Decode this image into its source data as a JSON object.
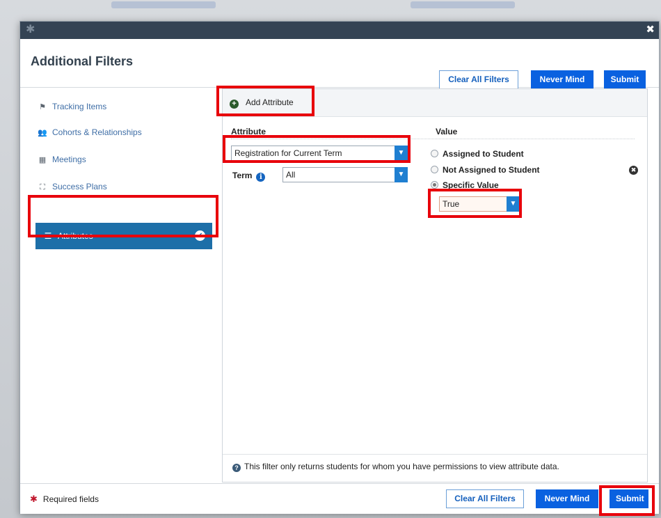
{
  "modal": {
    "title": "Additional Filters",
    "buttons": {
      "clear_all": "Clear All Filters",
      "never_mind": "Never Mind",
      "submit": "Submit"
    }
  },
  "sidebar": {
    "items": [
      {
        "label": "Tracking Items",
        "icon": "flag-icon"
      },
      {
        "label": "Cohorts & Relationships",
        "icon": "users-icon"
      },
      {
        "label": "Meetings",
        "icon": "calendar-icon"
      },
      {
        "label": "Success Plans",
        "icon": "plan-icon"
      },
      {
        "label": "Attributes",
        "icon": "sliders-icon",
        "active": true
      }
    ]
  },
  "content": {
    "add_attribute_label": "Add Attribute",
    "columns": {
      "attribute": "Attribute",
      "value": "Value"
    },
    "attribute_select": {
      "selected": "Registration for Current Term"
    },
    "term": {
      "label": "Term",
      "selected": "All"
    },
    "value_options": [
      {
        "label": "Assigned to Student",
        "checked": false
      },
      {
        "label": "Not Assigned to Student",
        "checked": false
      },
      {
        "label": "Specific Value",
        "checked": true
      }
    ],
    "specific_value_select": {
      "selected": "True"
    },
    "notice": "This filter only returns students for whom you have permissions to view attribute data."
  },
  "footer": {
    "required_label": "Required fields"
  },
  "colors": {
    "titlebar": "#344354",
    "primary": "#0a61e0",
    "active_nav": "#1d6fa8",
    "highlight": "#e8000b"
  }
}
